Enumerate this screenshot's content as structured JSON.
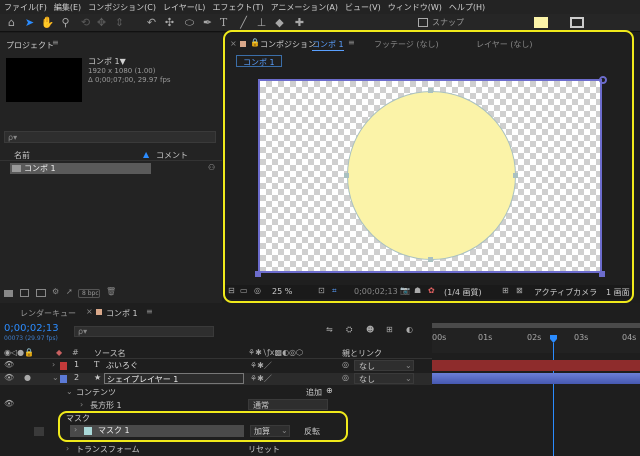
{
  "menu": [
    "ファイル(F)",
    "編集(E)",
    "コンポジション(C)",
    "レイヤー(L)",
    "エフェクト(T)",
    "アニメーション(A)",
    "ビュー(V)",
    "ウィンドウ(W)",
    "ヘルプ(H)"
  ],
  "toolbar": {
    "snap_label": "スナップ",
    "tool_icons": [
      "home-icon",
      "selection-arrow-icon",
      "hand-icon",
      "zoom-icon",
      "orbit-icon",
      "pan-icon",
      "dolly-icon",
      "rotate-icon",
      "anchor-icon",
      "ellipse-icon",
      "pen-icon",
      "type-icon",
      "brush-icon",
      "clone-stamp-icon",
      "eraser-icon",
      "puppet-icon"
    ]
  },
  "project": {
    "title": "プロジェクト",
    "comp_name": "コンポ 1▼",
    "comp_size": "1920 x 1080 (1.00)",
    "comp_duration": "Δ 0;00;07;00, 29.97 fps",
    "search_placeholder": "ρ▾",
    "col_name": "名前",
    "col_comment": "コメント",
    "item_name": "コンポ 1",
    "bpc": "8 bpc"
  },
  "viewer": {
    "tab_comp_prefix": "コンポジション",
    "tab_comp_name": "コンポ 1",
    "tab_footage": "フッテージ (なし)",
    "tab_layer": "レイヤー (なし)",
    "breadcrumb": "コンポ 1",
    "zoom": "25 %",
    "timecode": "0;00;02;13",
    "resolution": "(1/4 画質)",
    "camera": "アクティブカメラ",
    "views": "1 画面",
    "circle_color": "#fbf3a8"
  },
  "timeline": {
    "tab_render": "レンダーキュー",
    "tab_comp": "コンポ 1",
    "timecode": "0;00;02;13",
    "frame_info": "00073 (29.97 fps)",
    "search_placeholder": "ρ▾",
    "col_source": "ソース名",
    "col_parent": "親とリンク",
    "parent_none": "なし",
    "ruler": [
      "00s",
      "01s",
      "02s",
      "03s",
      "04s"
    ],
    "layers": [
      {
        "num": "1",
        "type": "T",
        "name": "ぶいろぐ",
        "color": "#c33a3a"
      },
      {
        "num": "2",
        "type": "★",
        "name": "シェイプレイヤー 1",
        "color": "#5c7ad6"
      }
    ],
    "contents": "コンテンツ",
    "add": "追加",
    "rectangle": "長方形 1",
    "blend_normal": "通常",
    "mask_group": "マスク",
    "mask_name": "マスク 1",
    "mask_mode": "加算",
    "invert": "反転",
    "transform": "トランスフォーム",
    "reset": "リセット"
  },
  "colors": {
    "highlight": "#f0ea1b",
    "accent_blue": "#2b8cff",
    "layer_red": "#c33a3a",
    "layer_blue": "#5c7ad6"
  }
}
